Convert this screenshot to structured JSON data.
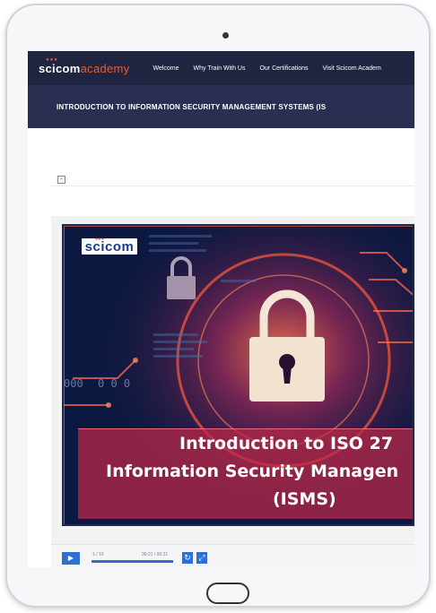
{
  "header": {
    "logo_main": "scicom",
    "logo_accent": "academy",
    "nav": [
      "Welcome",
      "Why Train With Us",
      "Our Certifications",
      "Visit Scicom Academ"
    ]
  },
  "course": {
    "title": "INTRODUCTION TO INFORMATION SECURITY MANAGEMENT SYSTEMS (IS"
  },
  "toc_toggle": "-",
  "slide": {
    "logo_text": "scicom",
    "caption_line1": "Introduction to ISO 27",
    "caption_line2": "Information Security Managen",
    "caption_line3": "(ISMS)"
  },
  "player": {
    "play_icon": "play-icon",
    "slide_count": "1 / 10",
    "time": "00:21 / 00:21",
    "progress": 1.0,
    "buttons": [
      "replay-icon",
      "fullscreen-icon"
    ]
  },
  "colors": {
    "nav_bg": "#1f2540",
    "course_bar_bg": "#2a2f52",
    "accent": "#f05a28",
    "player_blue": "#2e6fd4"
  }
}
